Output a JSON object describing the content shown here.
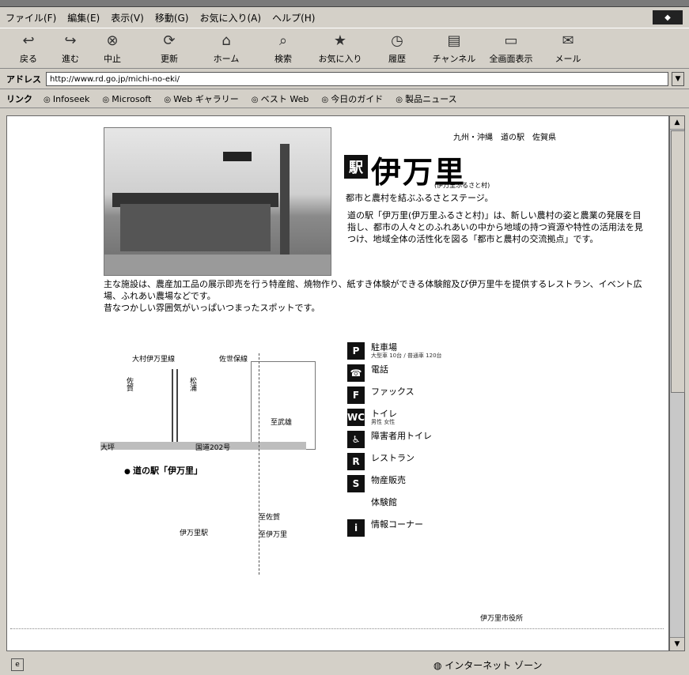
{
  "menu": [
    "ファイル(F)",
    "編集(E)",
    "表示(V)",
    "移動(G)",
    "お気に入り(A)",
    "ヘルプ(H)"
  ],
  "toolbar": [
    {
      "label": "戻る",
      "icon": "back-arrow-icon",
      "glyph": "↩"
    },
    {
      "label": "進む",
      "icon": "forward-arrow-icon",
      "glyph": "↪"
    },
    {
      "label": "中止",
      "icon": "stop-icon",
      "glyph": "⊗"
    },
    {
      "label": "更新",
      "icon": "refresh-icon",
      "glyph": "⟳"
    },
    {
      "label": "ホーム",
      "icon": "home-icon",
      "glyph": "⌂"
    },
    {
      "label": "検索",
      "icon": "search-icon",
      "glyph": "⌕"
    },
    {
      "label": "お気に入り",
      "icon": "favorites-icon",
      "glyph": "★"
    },
    {
      "label": "履歴",
      "icon": "history-icon",
      "glyph": "◷"
    },
    {
      "label": "チャンネル",
      "icon": "channels-icon",
      "glyph": "▤"
    },
    {
      "label": "全画面表示",
      "icon": "fullscreen-icon",
      "glyph": "▭"
    },
    {
      "label": "メール",
      "icon": "mail-icon",
      "glyph": "✉"
    }
  ],
  "address": {
    "label": "アドレス",
    "url": "http://www.rd.go.jp/michi-no-eki/"
  },
  "links": {
    "label": "リンク",
    "items": [
      "Infoseek",
      "Microsoft",
      "Web ギャラリー",
      "ベスト Web",
      "今日のガイド",
      "製品ニュース"
    ]
  },
  "page": {
    "breadcrumb": "九州・沖縄　道の駅　佐賀県",
    "logo_mark": "駅",
    "title": "伊万里",
    "subtitle": "(伊万里ふるさと村)",
    "tagline": "都市と農村を結ぶふるさとステージ。",
    "intro": "道の駅「伊万里(伊万里ふるさと村)」は、新しい農村の姿と農業の発展を目指し、都市の人々とのふれあいの中から地域の持つ資源や特性の活用法を見つけ、地域全体の活性化を図る「都市と農村の交流拠点」です。",
    "body_1": "主な施設は、農産加工品の展示即売を行う特産館、焼物作り、紙すき体験ができる体験館及び伊万里牛を提供するレストラン、イベント広場、ふれあい農場などです。",
    "body_2": "昔なつかしい雰囲気がいっぱいつまったスポットです。"
  },
  "map": {
    "station": "道の駅「伊万里」",
    "labels": [
      "大村伊万里線",
      "佐世保線",
      "国道202号",
      "大坪",
      "佐賀",
      "松浦",
      "至武雄",
      "至佐賀",
      "伊万里駅",
      "至伊万里"
    ]
  },
  "facilities": [
    {
      "icon": "parking-icon",
      "glyph": "P",
      "name": "駐車場",
      "sub": "大型車 10台 / 普通車 120台"
    },
    {
      "icon": "phone-icon",
      "glyph": "☎",
      "name": "電話",
      "sub": ""
    },
    {
      "icon": "fax-icon",
      "glyph": "F",
      "name": "ファックス",
      "sub": ""
    },
    {
      "icon": "toilet-icon",
      "glyph": "WC",
      "name": "トイレ",
      "sub": "男性 女性"
    },
    {
      "icon": "accessible-toilet-icon",
      "glyph": "♿",
      "name": "障害者用トイレ",
      "sub": ""
    },
    {
      "icon": "restaurant-icon",
      "glyph": "R",
      "name": "レストラン",
      "sub": ""
    },
    {
      "icon": "shop-icon",
      "glyph": "S",
      "name": "物産販売",
      "sub": ""
    },
    {
      "icon": "workshop-icon",
      "glyph": "",
      "name": "体験館",
      "sub": ""
    },
    {
      "icon": "info-icon",
      "glyph": "i",
      "name": "情報コーナー",
      "sub": ""
    }
  ],
  "footer": "伊万里市役所",
  "status": {
    "zone": "インターネット ゾーン"
  }
}
